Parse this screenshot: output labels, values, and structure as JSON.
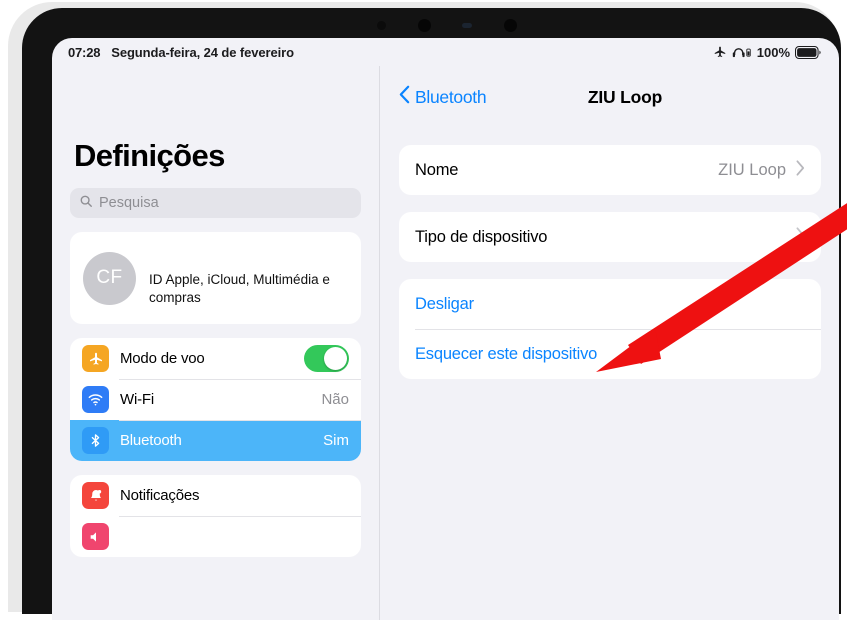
{
  "status_bar": {
    "time": "07:28",
    "date": "Segunda-feira, 24 de fevereiro",
    "airplane_icon": "airplane-icon",
    "headphones_icon": "headphones-battery-icon",
    "battery_percent": "100%",
    "battery_icon": "battery-full-icon"
  },
  "sidebar": {
    "title": "Definições",
    "search": {
      "placeholder": "Pesquisa",
      "icon": "search-icon"
    },
    "profile": {
      "initials": "CF",
      "description": "ID Apple, iCloud, Multimédia e compras"
    },
    "groups": [
      {
        "items": [
          {
            "label": "Modo de voo",
            "icon": "airplane-icon",
            "icon_color": "#f5a623",
            "control": "toggle",
            "toggle_on": true,
            "selected": false
          },
          {
            "label": "Wi-Fi",
            "icon": "wifi-icon",
            "icon_color": "#2f7cf6",
            "value": "Não",
            "selected": false
          },
          {
            "label": "Bluetooth",
            "icon": "bluetooth-icon",
            "icon_color": "#2f9bf6",
            "value": "Sim",
            "selected": true
          }
        ]
      },
      {
        "items": [
          {
            "label": "Notificações",
            "icon": "bell-icon",
            "icon_color": "#f4453c",
            "selected": false
          }
        ]
      }
    ]
  },
  "detail": {
    "back_label": "Bluetooth",
    "back_icon": "chevron-left-icon",
    "title": "ZIU Loop",
    "rows": [
      {
        "label": "Nome",
        "value": "ZIU Loop",
        "chevron": "chevron-right-icon"
      },
      {
        "label": "Tipo de dispositivo",
        "value": "",
        "chevron": "chevron-right-icon"
      }
    ],
    "actions": [
      {
        "label": "Desligar"
      },
      {
        "label": "Esquecer este dispositivo"
      }
    ]
  },
  "annotation": {
    "arrow_color": "#ee1111",
    "points_to": "Esquecer este dispositivo"
  },
  "theme": {
    "accent_blue": "#0a84ff",
    "selected_row_blue": "#4cb5f9",
    "toggle_green": "#33c85a",
    "page_background": "#f2f2f7"
  }
}
